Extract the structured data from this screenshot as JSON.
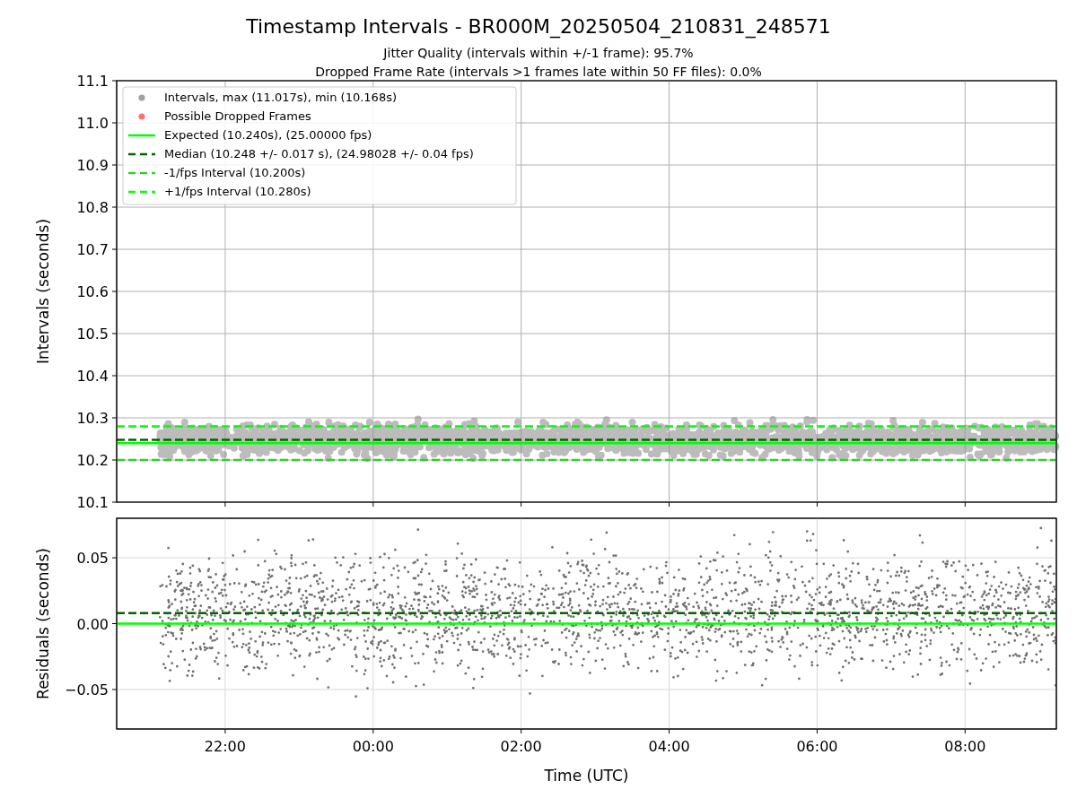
{
  "title": "Timestamp Intervals - BR000M_20250504_210831_248571",
  "subtitles": [
    "Jitter Quality (intervals within +/-1 frame): 95.7%",
    "Dropped Frame Rate (intervals >1 frames late within 50 FF files): 0.0%"
  ],
  "legend_markers": [
    {
      "label": "Intervals, max (11.017s), min (10.168s)",
      "color": "#a0a0a0"
    },
    {
      "label": "Possible Dropped Frames",
      "color": "#ff7070"
    }
  ],
  "panels": [
    {
      "chart_data": {
        "type": "line",
        "ylabel": "Intervals (seconds)",
        "legend": "upper left",
        "grid": true,
        "x": [
          "2025-05-04T20:32",
          "2025-05-05T09:14"
        ],
        "xlim": [
          "2025-05-04T20:32",
          "2025-05-05T09:14"
        ],
        "ylim": [
          10.1,
          11.1
        ],
        "yticks": [
          {
            "value": 10.1,
            "label": "10.1"
          },
          {
            "value": 10.2,
            "label": "10.2"
          },
          {
            "value": 10.3,
            "label": "10.3"
          },
          {
            "value": 10.4,
            "label": "10.4"
          },
          {
            "value": 10.5,
            "label": "10.5"
          },
          {
            "value": 10.6,
            "label": "10.6"
          },
          {
            "value": 10.7,
            "label": "10.7"
          },
          {
            "value": 10.8,
            "label": "10.8"
          },
          {
            "value": 10.9,
            "label": "10.9"
          },
          {
            "value": 11.0,
            "label": "11.0"
          },
          {
            "value": 11.1,
            "label": "11.1"
          }
        ],
        "series": [
          {
            "name": "Expected (10.240s), (25.00000 fps)",
            "color": "#00ff00",
            "line_style": "solid",
            "values": [
              10.24,
              10.24
            ]
          },
          {
            "name": "Median (10.248 +/- 0.017 s), (24.98028 +/- 0.04 fps)",
            "color": "#006400",
            "line_style": "dashed",
            "values": [
              10.248,
              10.248
            ]
          },
          {
            "name": "-1/fps Interval (10.200s)",
            "color": "#32cd32",
            "line_style": "dashed",
            "values": [
              10.2,
              10.2
            ]
          },
          {
            "name": "+1/fps Interval (10.280s)",
            "color": "#00ff00",
            "line_style": "dashed",
            "values": [
              10.28,
              10.28
            ]
          }
        ]
      }
    },
    {
      "chart_data": {
        "type": "line",
        "xlabel": "Time (UTC)",
        "ylabel": "Residuals (seconds)",
        "grid": true,
        "x": [
          "2025-05-04T20:32",
          "2025-05-05T09:14"
        ],
        "xlim": [
          "2025-05-04T20:32",
          "2025-05-05T09:14"
        ],
        "ylim": [
          -0.08,
          0.08
        ],
        "xticks": [
          {
            "value": "2025-05-04T22:00",
            "label": "22:00"
          },
          {
            "value": "2025-05-05T00:00",
            "label": "00:00"
          },
          {
            "value": "2025-05-05T02:00",
            "label": "02:00"
          },
          {
            "value": "2025-05-05T04:00",
            "label": "04:00"
          },
          {
            "value": "2025-05-05T06:00",
            "label": "06:00"
          },
          {
            "value": "2025-05-05T08:00",
            "label": "08:00"
          }
        ],
        "yticks": [
          {
            "value": -0.05,
            "label": "−0.05"
          },
          {
            "value": 0,
            "label": "0.00"
          },
          {
            "value": 0.05,
            "label": "0.05"
          }
        ],
        "series": [
          {
            "color": "#00ff00",
            "line_style": "solid",
            "values": [
              0,
              0
            ]
          },
          {
            "color": "#006400",
            "line_style": "dashed",
            "values": [
              0.008,
              0.008
            ]
          }
        ]
      }
    }
  ]
}
